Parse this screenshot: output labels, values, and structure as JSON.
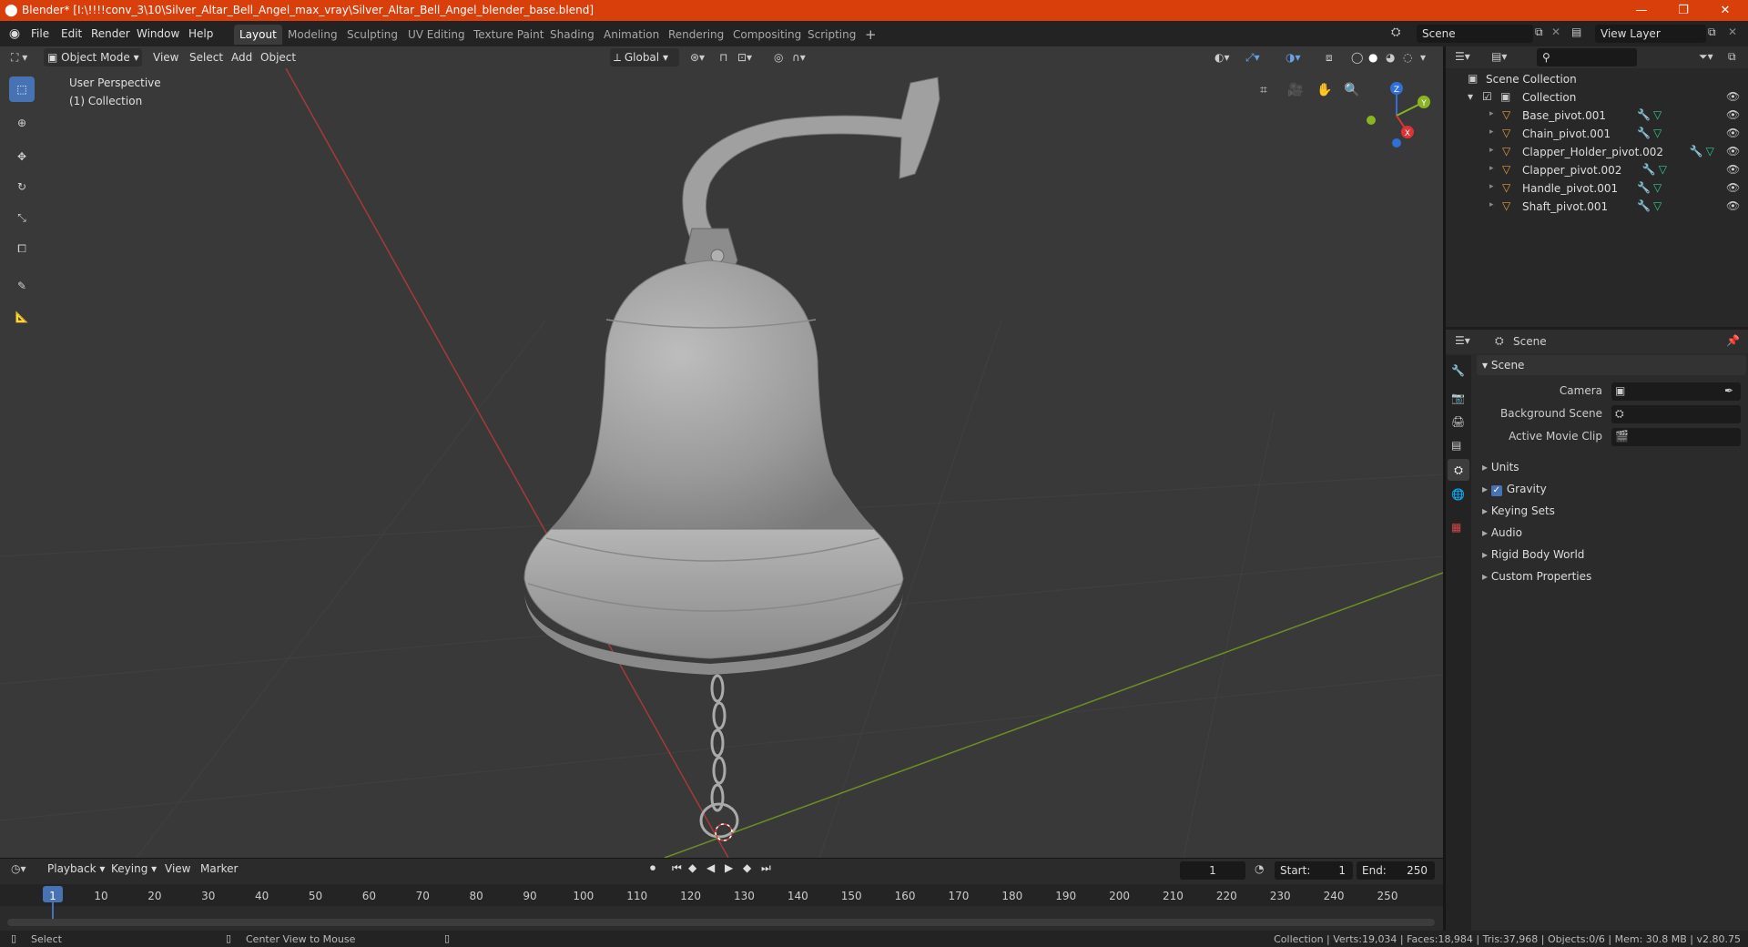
{
  "titlebar": {
    "title": "Blender* [I:\\!!!!conv_3\\10\\Silver_Altar_Bell_Angel_max_vray\\Silver_Altar_Bell_Angel_blender_base.blend]"
  },
  "menu": {
    "file": "File",
    "edit": "Edit",
    "render": "Render",
    "window": "Window",
    "help": "Help"
  },
  "workspaces": [
    "Layout",
    "Modeling",
    "Sculpting",
    "UV Editing",
    "Texture Paint",
    "Shading",
    "Animation",
    "Rendering",
    "Compositing",
    "Scripting"
  ],
  "scene": {
    "name": "Scene"
  },
  "view_layer": {
    "name": "View Layer"
  },
  "viewport": {
    "mode": "Object Mode",
    "view": "View",
    "select": "Select",
    "add": "Add",
    "object": "Object",
    "orientation": "Global",
    "overlay_line1": "User Perspective",
    "overlay_line2": "(1) Collection"
  },
  "gizmo": {
    "x": "X",
    "y": "Y",
    "z": "Z"
  },
  "outliner": {
    "root": "Scene Collection",
    "collection": "Collection",
    "items": [
      "Base_pivot.001",
      "Chain_pivot.001",
      "Clapper_Holder_pivot.002",
      "Clapper_pivot.002",
      "Handle_pivot.001",
      "Shaft_pivot.001"
    ]
  },
  "properties": {
    "header": "Scene",
    "section": "Scene",
    "camera_label": "Camera",
    "bg_scene_label": "Background Scene",
    "movie_clip_label": "Active Movie Clip",
    "subsections": [
      "Units",
      "Gravity",
      "Keying Sets",
      "Audio",
      "Rigid Body World",
      "Custom Properties"
    ]
  },
  "timeline": {
    "playback": "Playback",
    "keying": "Keying",
    "view": "View",
    "marker": "Marker",
    "current_frame": "1",
    "start_label": "Start:",
    "start": "1",
    "end_label": "End:",
    "end": "250",
    "ticks": [
      "1",
      "10",
      "20",
      "30",
      "40",
      "50",
      "60",
      "70",
      "80",
      "90",
      "100",
      "110",
      "120",
      "130",
      "140",
      "150",
      "160",
      "170",
      "180",
      "190",
      "200",
      "210",
      "220",
      "230",
      "240",
      "250"
    ]
  },
  "status": {
    "left1": "Select",
    "left2": "Center View to Mouse",
    "right": "Collection | Verts:19,034 | Faces:18,984 | Tris:37,968 | Objects:0/6 | Mem: 30.8 MB | v2.80.75"
  },
  "colors": {
    "accent": "#4772b3",
    "titlebar": "#d93f0b",
    "object_icon": "#e79b4a",
    "mesh_icon": "#35c98f"
  }
}
